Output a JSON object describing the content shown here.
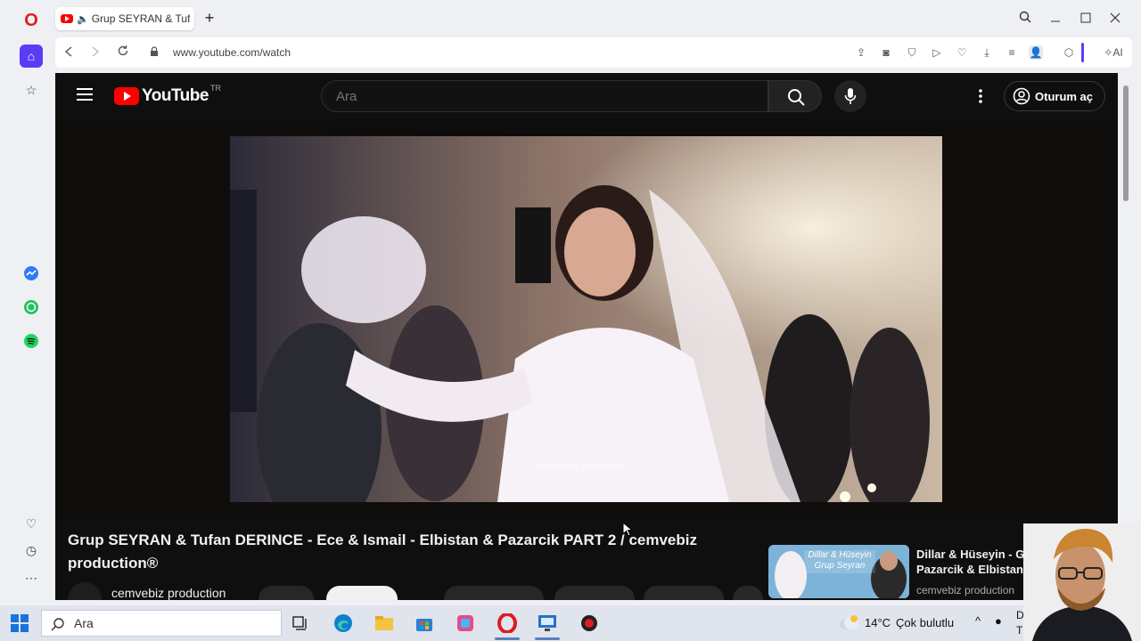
{
  "browser": {
    "tab_title": "Grup SEYRAN & Tufan",
    "url": "www.youtube.com/watch",
    "ai_label": "AI"
  },
  "youtube": {
    "logo_text": "YouTube",
    "region": "TR",
    "search_placeholder": "Ara",
    "signin_label": "Oturum aç",
    "watermark": "cemvebiz production",
    "video_title": "Grup SEYRAN & Tufan DERINCE - Ece & Ismail - Elbistan & Pazarcik PART 2 / cemvebiz production®",
    "channel_name": "cemvebiz production",
    "related": {
      "title_line1": "Dillar & Hüseyin - Gru",
      "title_line2": "Pazarcik & Elbistan D",
      "channel": "cemvebiz production",
      "thumb_text": "Dillar & Hüseyin Grup Seyran"
    }
  },
  "taskbar": {
    "search_label": "Ara",
    "temperature": "14°C",
    "weather": "Çok bulutlu",
    "clock_fragment_1": "D",
    "clock_fragment_2": "T"
  },
  "colors": {
    "youtube_red": "#ff0000",
    "opera_red": "#e01b24",
    "opera_sidebar_active": "#5b3cf5"
  }
}
